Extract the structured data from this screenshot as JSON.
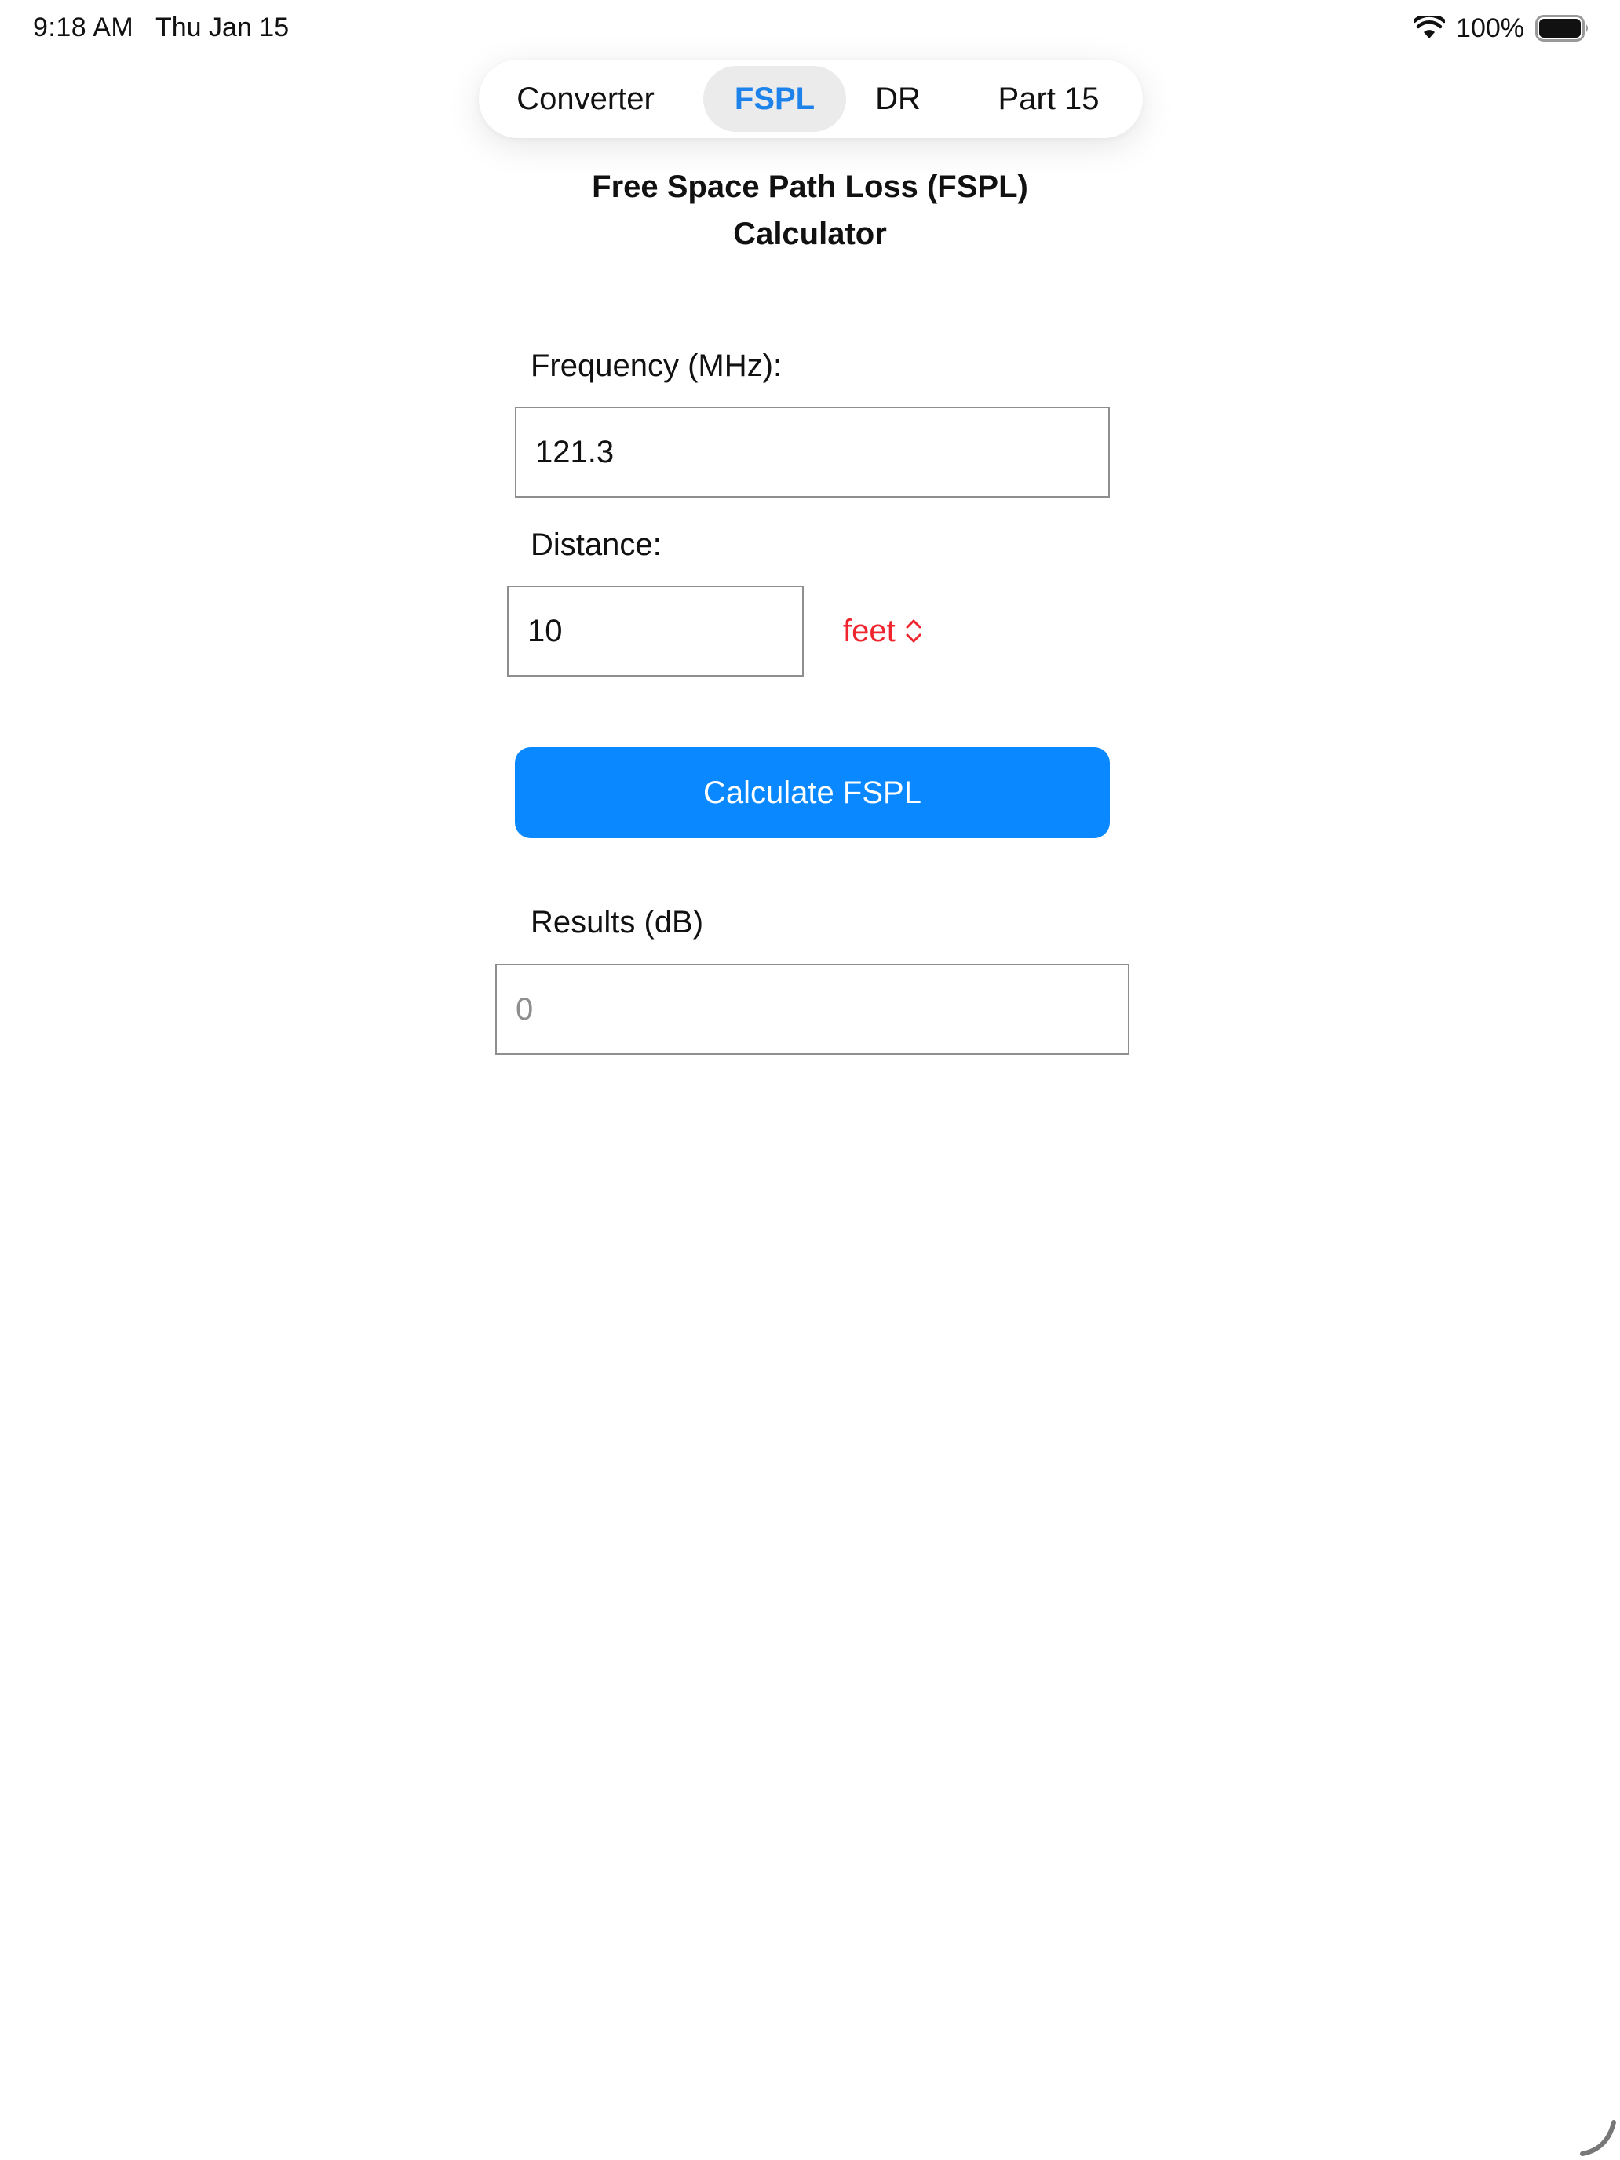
{
  "status_bar": {
    "time": "9:18 AM",
    "date": "Thu Jan 15",
    "battery_percent": "100%"
  },
  "tabs": [
    {
      "label": "Converter",
      "active": false
    },
    {
      "label": "FSPL",
      "active": true
    },
    {
      "label": "DR",
      "active": false
    },
    {
      "label": "Part 15",
      "active": false
    }
  ],
  "page": {
    "title": "Free Space Path Loss (FSPL)\nCalculator"
  },
  "form": {
    "frequency_label": "Frequency (MHz):",
    "frequency_value": "121.3",
    "distance_label": "Distance:",
    "distance_value": "10",
    "distance_unit": "feet",
    "calculate_label": "Calculate FSPL",
    "results_label": "Results (dB)",
    "results_placeholder": "0"
  },
  "colors": {
    "accent": "#0a88ff",
    "active_tab_text": "#1e82eb",
    "unit_picker": "#f0242c",
    "border": "#8e8e8e"
  }
}
